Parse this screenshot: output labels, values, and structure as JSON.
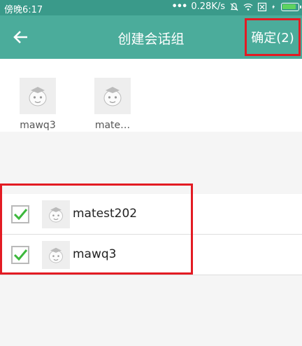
{
  "status_bar": {
    "time": "傍晚6:17",
    "speed": "0.28K/s"
  },
  "app_bar": {
    "title": "创建会话组",
    "confirm_label": "确定(2)"
  },
  "selected": [
    {
      "name": "mawq3"
    },
    {
      "name": "mate…"
    }
  ],
  "contacts": [
    {
      "name": "matest202",
      "checked": true
    },
    {
      "name": "mawq3",
      "checked": true
    }
  ],
  "colors": {
    "accent": "#4bac9b",
    "highlight": "#e31b23",
    "check": "#3cb83c"
  },
  "icons": [
    "back-arrow-icon",
    "checkbox-checked-icon",
    "avatar-placeholder-icon",
    "wifi-icon",
    "mute-icon",
    "battery-icon"
  ]
}
